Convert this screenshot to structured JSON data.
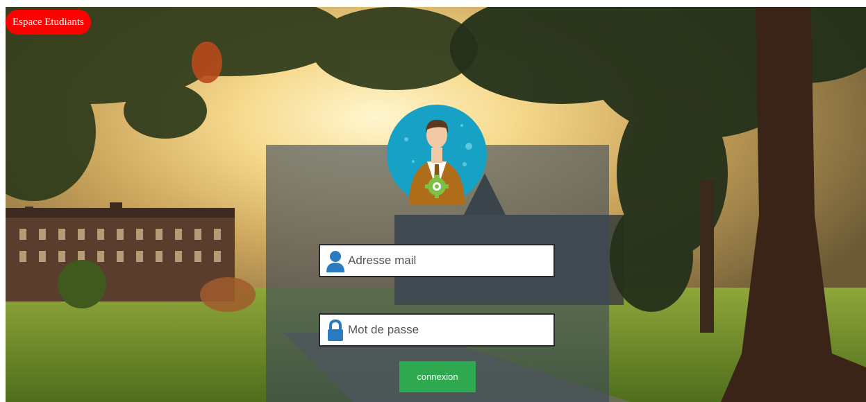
{
  "header": {
    "badge_label": "Espace Etudiants",
    "badge_color": "#ff0000"
  },
  "login": {
    "avatar_icon": "user-manager-icon",
    "email": {
      "placeholder": "Adresse mail",
      "value": "",
      "icon": "user-icon"
    },
    "password": {
      "placeholder": "Mot de passe",
      "value": "",
      "icon": "lock-icon"
    },
    "submit_label": "connexion",
    "submit_color": "#2ea94f",
    "icon_color": "#2a7bc0"
  },
  "background": {
    "description_icon": "campus-photo"
  }
}
